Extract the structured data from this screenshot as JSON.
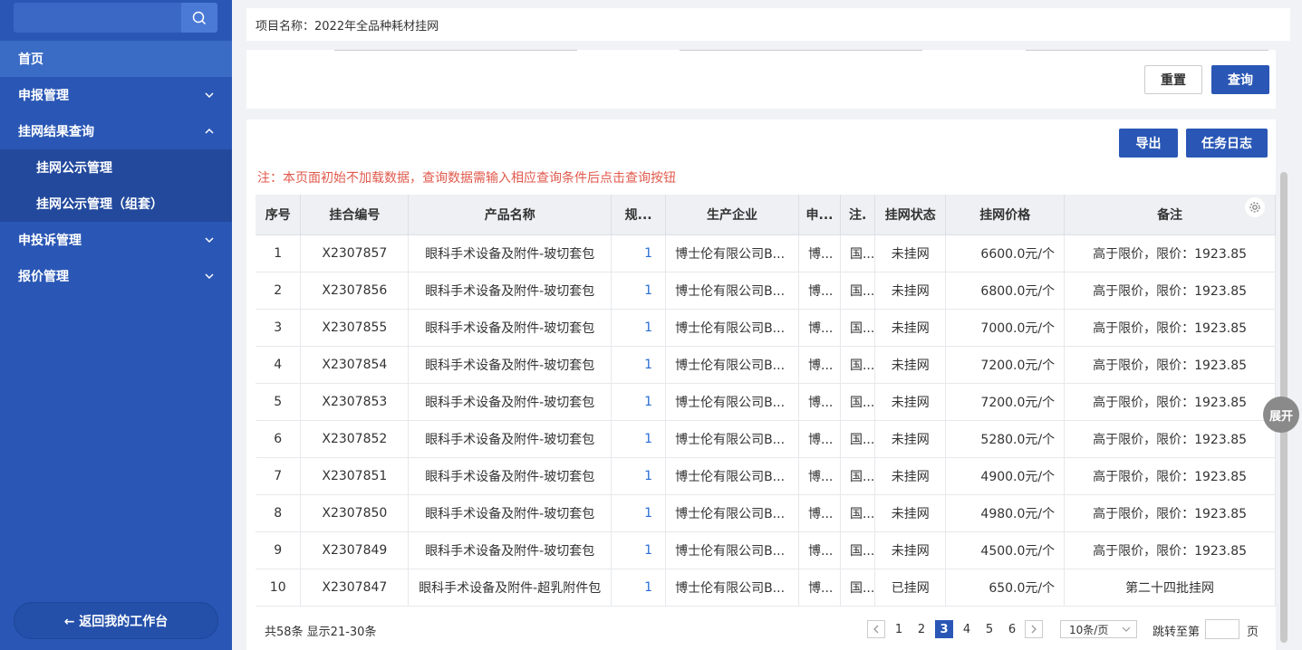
{
  "sidebar": {
    "search": {
      "placeholder": ""
    },
    "items": [
      {
        "label": "首页"
      },
      {
        "label": "申报管理"
      },
      {
        "label": "挂网结果查询"
      },
      {
        "label": "挂网公示管理"
      },
      {
        "label": "挂网公示管理（组套）"
      },
      {
        "label": "申投诉管理"
      },
      {
        "label": "报价管理"
      }
    ],
    "back_label": "← 返回我的工作台"
  },
  "project": {
    "label": "项目名称：2022年全品种耗材挂网"
  },
  "actions": {
    "reset": "重置",
    "query": "查询",
    "export": "导出",
    "task_log": "任务日志",
    "expand": "展开"
  },
  "notice": "注：本页面初始不加载数据，查询数据需输入相应查询条件后点击查询按钮",
  "table": {
    "headers": [
      "序号",
      "挂合编号",
      "产品名称",
      "规...",
      "生产企业",
      "申...",
      "注.",
      "挂网状态",
      "挂网价格",
      "备注"
    ],
    "rows": [
      {
        "no": "1",
        "code": "X2307857",
        "name": "眼科手术设备及附件-玻切套包",
        "spec": "1",
        "maker": "博士伦有限公司B...",
        "applicant": "博...",
        "reg": "国...",
        "status": "未挂网",
        "price": "6600.0元/个",
        "remark": "高于限价，限价：1923.85"
      },
      {
        "no": "2",
        "code": "X2307856",
        "name": "眼科手术设备及附件-玻切套包",
        "spec": "1",
        "maker": "博士伦有限公司B...",
        "applicant": "博...",
        "reg": "国...",
        "status": "未挂网",
        "price": "6800.0元/个",
        "remark": "高于限价，限价：1923.85"
      },
      {
        "no": "3",
        "code": "X2307855",
        "name": "眼科手术设备及附件-玻切套包",
        "spec": "1",
        "maker": "博士伦有限公司B...",
        "applicant": "博...",
        "reg": "国...",
        "status": "未挂网",
        "price": "7000.0元/个",
        "remark": "高于限价，限价：1923.85"
      },
      {
        "no": "4",
        "code": "X2307854",
        "name": "眼科手术设备及附件-玻切套包",
        "spec": "1",
        "maker": "博士伦有限公司B...",
        "applicant": "博...",
        "reg": "国...",
        "status": "未挂网",
        "price": "7200.0元/个",
        "remark": "高于限价，限价：1923.85"
      },
      {
        "no": "5",
        "code": "X2307853",
        "name": "眼科手术设备及附件-玻切套包",
        "spec": "1",
        "maker": "博士伦有限公司B...",
        "applicant": "博...",
        "reg": "国...",
        "status": "未挂网",
        "price": "7200.0元/个",
        "remark": "高于限价，限价：1923.85"
      },
      {
        "no": "6",
        "code": "X2307852",
        "name": "眼科手术设备及附件-玻切套包",
        "spec": "1",
        "maker": "博士伦有限公司B...",
        "applicant": "博...",
        "reg": "国...",
        "status": "未挂网",
        "price": "5280.0元/个",
        "remark": "高于限价，限价：1923.85"
      },
      {
        "no": "7",
        "code": "X2307851",
        "name": "眼科手术设备及附件-玻切套包",
        "spec": "1",
        "maker": "博士伦有限公司B...",
        "applicant": "博...",
        "reg": "国...",
        "status": "未挂网",
        "price": "4900.0元/个",
        "remark": "高于限价，限价：1923.85"
      },
      {
        "no": "8",
        "code": "X2307850",
        "name": "眼科手术设备及附件-玻切套包",
        "spec": "1",
        "maker": "博士伦有限公司B...",
        "applicant": "博...",
        "reg": "国...",
        "status": "未挂网",
        "price": "4980.0元/个",
        "remark": "高于限价，限价：1923.85"
      },
      {
        "no": "9",
        "code": "X2307849",
        "name": "眼科手术设备及附件-玻切套包",
        "spec": "1",
        "maker": "博士伦有限公司B...",
        "applicant": "博...",
        "reg": "国...",
        "status": "未挂网",
        "price": "4500.0元/个",
        "remark": "高于限价，限价：1923.85"
      },
      {
        "no": "10",
        "code": "X2307847",
        "name": "眼科手术设备及附件-超乳附件包",
        "spec": "1",
        "maker": "博士伦有限公司B...",
        "applicant": "博...",
        "reg": "国...",
        "status": "已挂网",
        "price": "650.0元/个",
        "remark": "第二十四批挂网"
      }
    ]
  },
  "pagination": {
    "summary": "共58条 显示21-30条",
    "pages": [
      "1",
      "2",
      "3",
      "4",
      "5",
      "6"
    ],
    "current": "3",
    "page_size": "10条/页",
    "jump_label": "跳转至第",
    "page_suffix": "页"
  },
  "colors": {
    "sidebar_bg": "#2a57b5",
    "primary": "#2a57b5",
    "notice": "#e0594c",
    "link": "#2a6fd6"
  }
}
